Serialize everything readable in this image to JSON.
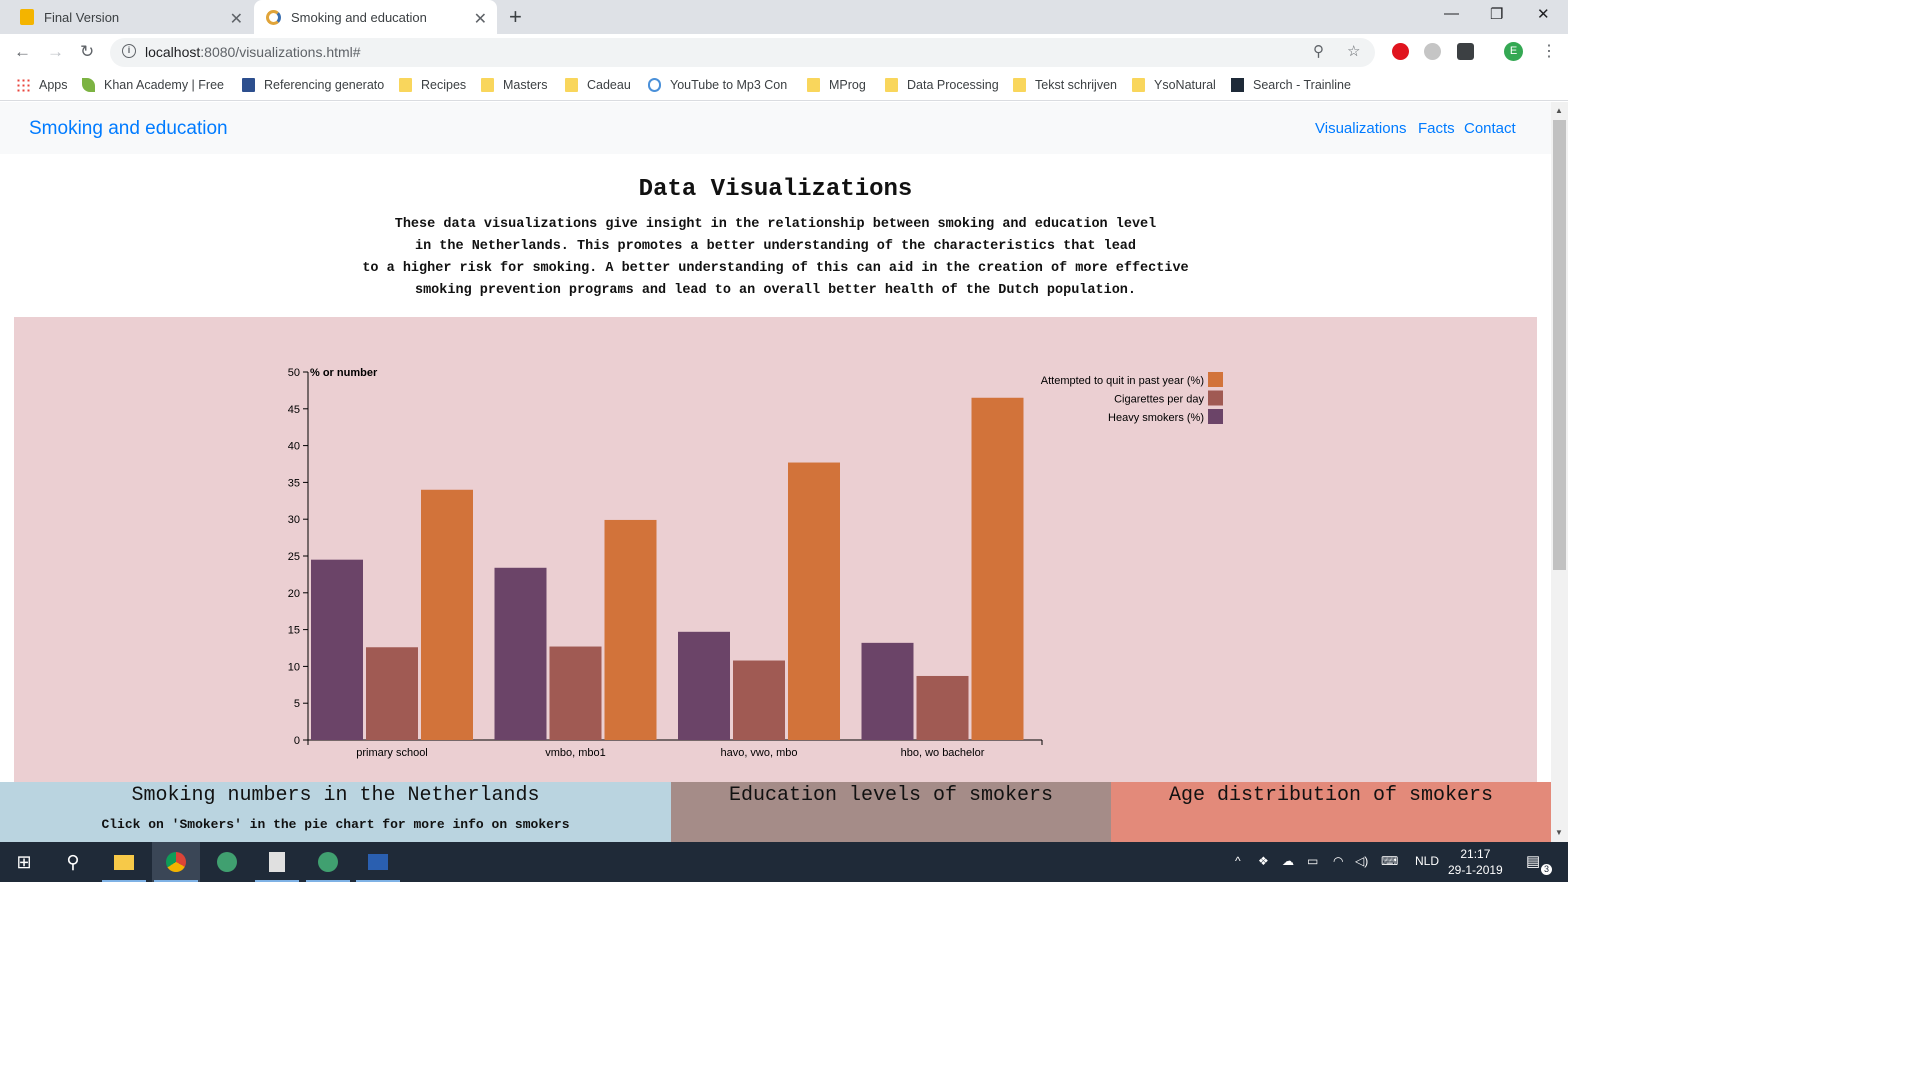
{
  "browser": {
    "tabs": [
      {
        "title": "Final Version",
        "active": false
      },
      {
        "title": "Smoking and education",
        "active": true
      }
    ],
    "url_host": "localhost",
    "url_rest": ":8080/visualizations.html#",
    "bookmarks": [
      {
        "label": "Apps",
        "icon": "apps-grid-icon"
      },
      {
        "label": "Khan Academy | Free",
        "icon": "khan-leaf-icon"
      },
      {
        "label": "Referencing generato",
        "icon": "book-icon"
      },
      {
        "label": "Recipes",
        "icon": "folder-icon"
      },
      {
        "label": "Masters",
        "icon": "folder-icon"
      },
      {
        "label": "Cadeau",
        "icon": "folder-icon"
      },
      {
        "label": "YouTube to Mp3 Con",
        "icon": "cloud-download-icon"
      },
      {
        "label": "MProg",
        "icon": "folder-icon"
      },
      {
        "label": "Data Processing",
        "icon": "folder-icon"
      },
      {
        "label": "Tekst schrijven",
        "icon": "folder-icon"
      },
      {
        "label": "YsoNatural",
        "icon": "folder-icon"
      },
      {
        "label": "Search - Trainline",
        "icon": "trainline-icon"
      }
    ],
    "profile_initial": "E"
  },
  "site": {
    "brand": "Smoking and education",
    "nav": [
      "Visualizations",
      "Facts",
      "Contact"
    ],
    "heading": "Data Visualizations",
    "intro_lines": [
      "These data visualizations give insight in the relationship between smoking and education level",
      "in the Netherlands. This promotes a better understanding of the characteristics that lead",
      "to a higher risk for smoking. A better understanding of this can aid in the creation of more effective",
      "smoking prevention programs and lead to an overall better health of the Dutch population."
    ],
    "cards": [
      {
        "title": "Smoking numbers in the Netherlands",
        "subtitle": "Click on 'Smokers' in the pie chart for more info on smokers"
      },
      {
        "title": "Education levels of smokers"
      },
      {
        "title": "Age distribution of smokers"
      }
    ]
  },
  "chart_data": {
    "type": "bar",
    "ylabel": "% or number",
    "ylim": [
      0,
      50
    ],
    "yticks": [
      0,
      5,
      10,
      15,
      20,
      25,
      30,
      35,
      40,
      45,
      50
    ],
    "categories": [
      "primary school",
      "vmbo, mbo1",
      "havo, vwo, mbo",
      "hbo, wo bachelor"
    ],
    "series": [
      {
        "name": "Heavy smokers (%)",
        "color": "#6b4468",
        "values": [
          24.5,
          23.4,
          14.7,
          13.2
        ]
      },
      {
        "name": "Cigarettes per day",
        "color": "#a05a53",
        "values": [
          12.6,
          12.7,
          10.8,
          8.7
        ]
      },
      {
        "name": "Attempted to quit in past year (%)",
        "color": "#d2733a",
        "values": [
          34.0,
          29.9,
          37.7,
          46.5
        ]
      }
    ],
    "legend_order": [
      2,
      1,
      0
    ],
    "legend_position": "top-right"
  },
  "taskbar": {
    "language": "NLD",
    "time": "21:17",
    "date": "29-1-2019",
    "notifications": "3"
  }
}
